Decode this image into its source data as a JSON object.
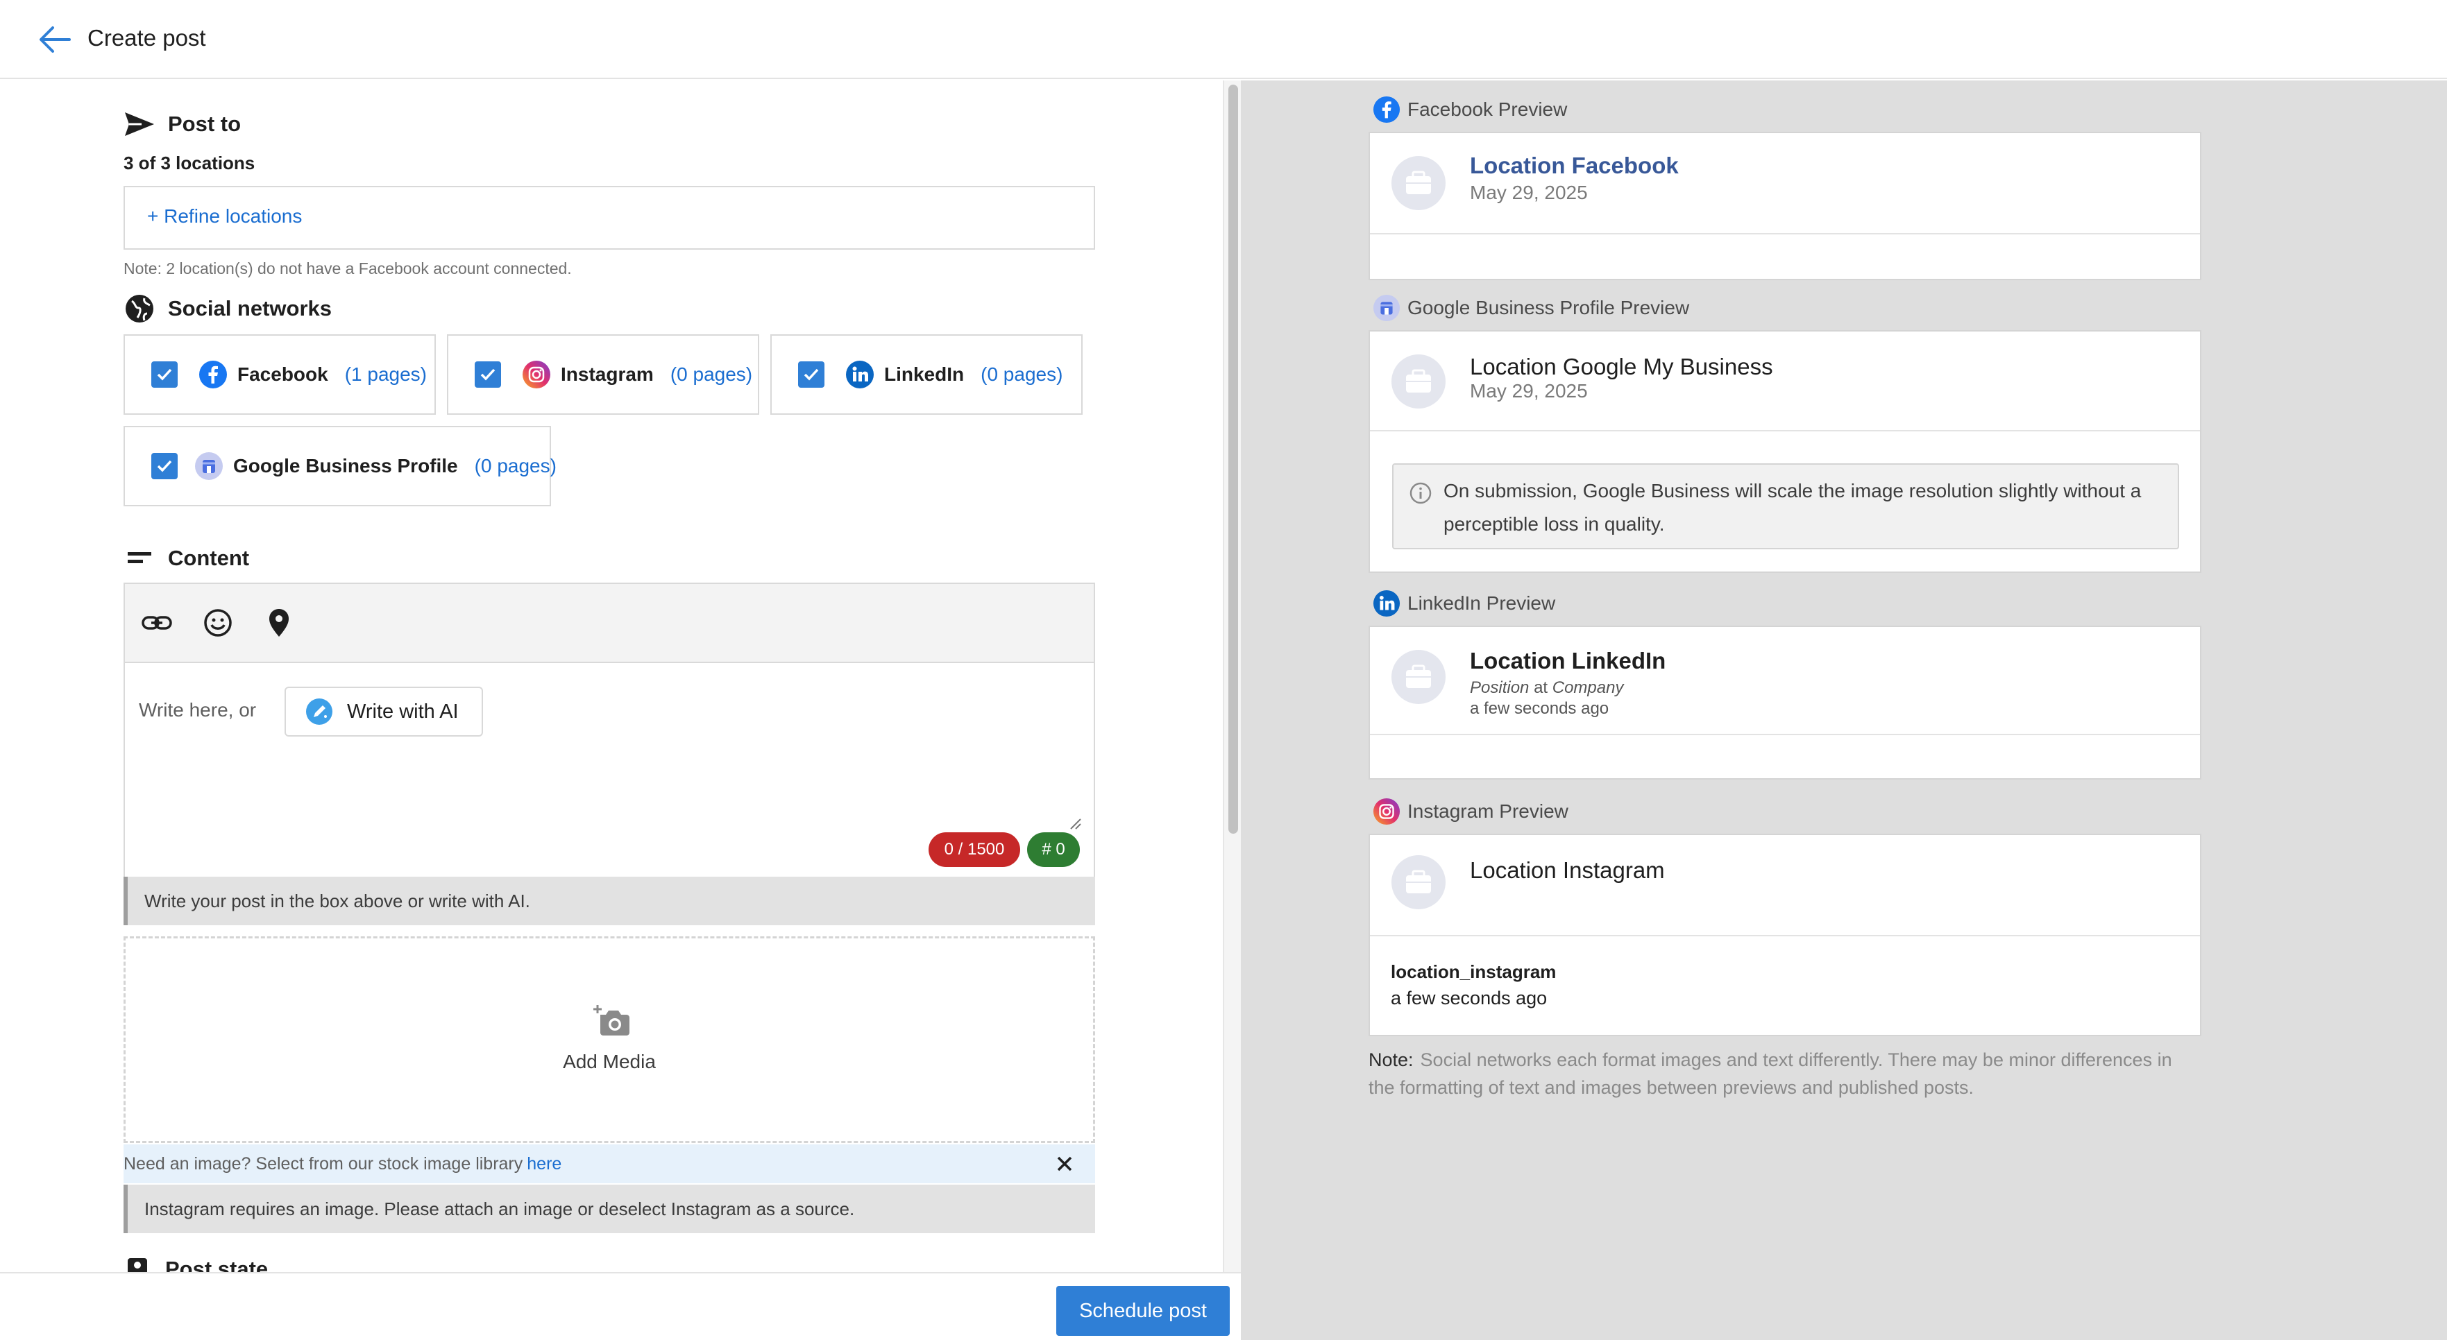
{
  "header": {
    "title": "Create post"
  },
  "post_to": {
    "title": "Post to",
    "count": "3 of 3 locations",
    "refine_label": "+ Refine locations",
    "note": "Note: 2 location(s) do not have a Facebook account connected."
  },
  "social": {
    "title": "Social networks",
    "networks": [
      {
        "name": "Facebook",
        "pages": "(1 pages)",
        "checked": true,
        "icon": "facebook-icon",
        "color": "#1877f2"
      },
      {
        "name": "Instagram",
        "pages": "(0 pages)",
        "checked": true,
        "icon": "instagram-icon",
        "color": "#e1306c"
      },
      {
        "name": "LinkedIn",
        "pages": "(0 pages)",
        "checked": true,
        "icon": "linkedin-icon",
        "color": "#0a66c2"
      },
      {
        "name": "Google Business Profile",
        "pages": "(0 pages)",
        "checked": true,
        "icon": "google-business-icon",
        "color": "#4a6ee0"
      }
    ]
  },
  "content": {
    "title": "Content",
    "toolbar": {
      "icons": [
        "link-icon",
        "emoji-icon",
        "location-pin-icon"
      ]
    },
    "write_prompt": "Write here, or",
    "ai_button": "Write with AI",
    "char_count": "0 / 1500",
    "hashtag_count": "# 0",
    "hint": "Write your post in the box above or write with AI.",
    "add_media": "Add Media",
    "stock_prompt": "Need an image? Select from our stock image library",
    "stock_link": "here",
    "instagram_warning": "Instagram requires an image. Please attach an image or deselect Instagram as a source."
  },
  "post_state": {
    "title": "Post state"
  },
  "footer": {
    "schedule_button": "Schedule post"
  },
  "previews": {
    "facebook": {
      "heading": "Facebook Preview",
      "name": "Location Facebook",
      "date": "May 29, 2025"
    },
    "google": {
      "heading": "Google Business Profile Preview",
      "name": "Location Google My Business",
      "date": "May 29, 2025",
      "info": "On submission, Google Business will scale the image resolution slightly without a perceptible loss in quality."
    },
    "linkedin": {
      "heading": "LinkedIn Preview",
      "name": "Location LinkedIn",
      "position": "Position",
      "at": "at",
      "company": "Company",
      "time": "a few seconds ago"
    },
    "instagram": {
      "heading": "Instagram Preview",
      "name": "Location Instagram",
      "username": "location_instagram",
      "time": "a few seconds ago"
    },
    "note_label": "Note:",
    "note": "Social networks each format images and text differently. There may be minor differences in the formatting of text and images between previews and published posts."
  },
  "colors": {
    "accent": "#2f7fd6",
    "link": "#1a6dd0",
    "char_pill": "#c62828",
    "hash_pill": "#2e7d32",
    "preview_bg": "#dedede"
  }
}
